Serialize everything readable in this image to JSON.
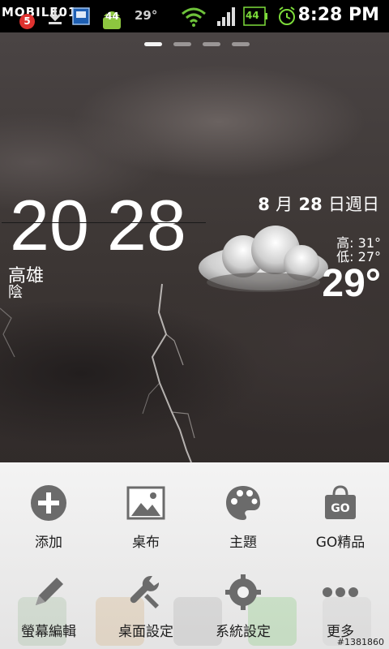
{
  "status_bar": {
    "logo": "MOBILE01",
    "notification_count": "5",
    "android_count": "44",
    "temperature": "29°",
    "battery": "44",
    "time": "8:28 PM"
  },
  "home": {
    "page_count": 4,
    "active_page": 0
  },
  "weather_widget": {
    "hour": "20",
    "minute": "28",
    "city": "高雄",
    "condition": "陰",
    "month": "8",
    "month_label": "月",
    "day": "28",
    "weekday": "日週日",
    "high": "高:  31°",
    "low": "低:  27°",
    "current_temp": "29°"
  },
  "menu": {
    "items": [
      {
        "label": "添加",
        "icon": "add-icon"
      },
      {
        "label": "桌布",
        "icon": "wallpaper-icon"
      },
      {
        "label": "主題",
        "icon": "palette-icon"
      },
      {
        "label": "GO精品",
        "icon": "shopping-bag-icon"
      },
      {
        "label": "螢幕編輯",
        "icon": "pencil-icon"
      },
      {
        "label": "桌面設定",
        "icon": "wrench-icon"
      },
      {
        "label": "系統設定",
        "icon": "gear-icon"
      },
      {
        "label": "更多",
        "icon": "more-icon"
      }
    ]
  },
  "watermark": "#1381860",
  "colors": {
    "menu_bg": "#f5f5f5",
    "icon_gray": "#6b6b6b",
    "status_green": "#7ddc3a",
    "badge_red": "#e0322f"
  }
}
